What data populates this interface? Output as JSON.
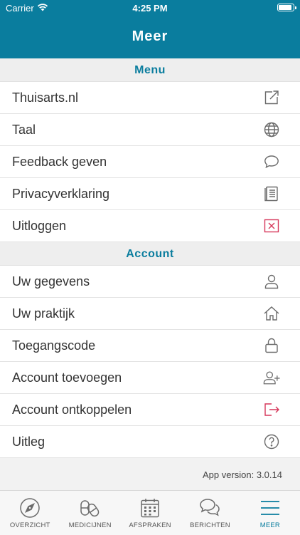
{
  "status": {
    "carrier": "Carrier",
    "time": "4:25 PM",
    "battery_level": 0.95
  },
  "nav": {
    "title": "Meer"
  },
  "menu": {
    "header": "Menu",
    "items": [
      {
        "label": "Thuisarts.nl",
        "icon": "external-link-icon"
      },
      {
        "label": "Taal",
        "icon": "globe-icon"
      },
      {
        "label": "Feedback geven",
        "icon": "chat-bubble-icon"
      },
      {
        "label": "Privacyverklaring",
        "icon": "document-icon"
      },
      {
        "label": "Uitloggen",
        "icon": "logout-x-icon"
      }
    ]
  },
  "account": {
    "header": "Account",
    "items": [
      {
        "label": "Uw gegevens",
        "icon": "user-icon"
      },
      {
        "label": "Uw praktijk",
        "icon": "home-icon"
      },
      {
        "label": "Toegangscode",
        "icon": "lock-icon"
      },
      {
        "label": "Account toevoegen",
        "icon": "add-user-icon"
      },
      {
        "label": "Account ontkoppelen",
        "icon": "unlink-arrow-icon"
      },
      {
        "label": "Uitleg",
        "icon": "help-icon"
      }
    ]
  },
  "app_version": "App version: 3.0.14",
  "tabs": [
    {
      "label": "OVERZICHT",
      "icon": "compass-icon",
      "active": false
    },
    {
      "label": "MEDICIJNEN",
      "icon": "pills-icon",
      "active": false
    },
    {
      "label": "AFSPRAKEN",
      "icon": "calendar-icon",
      "active": false
    },
    {
      "label": "BERICHTEN",
      "icon": "messages-icon",
      "active": false
    },
    {
      "label": "MEER",
      "icon": "menu-icon",
      "active": true
    }
  ],
  "colors": {
    "primary": "#0a7d9e",
    "danger": "#d6375a",
    "icon_gray": "#6b6b6b"
  }
}
